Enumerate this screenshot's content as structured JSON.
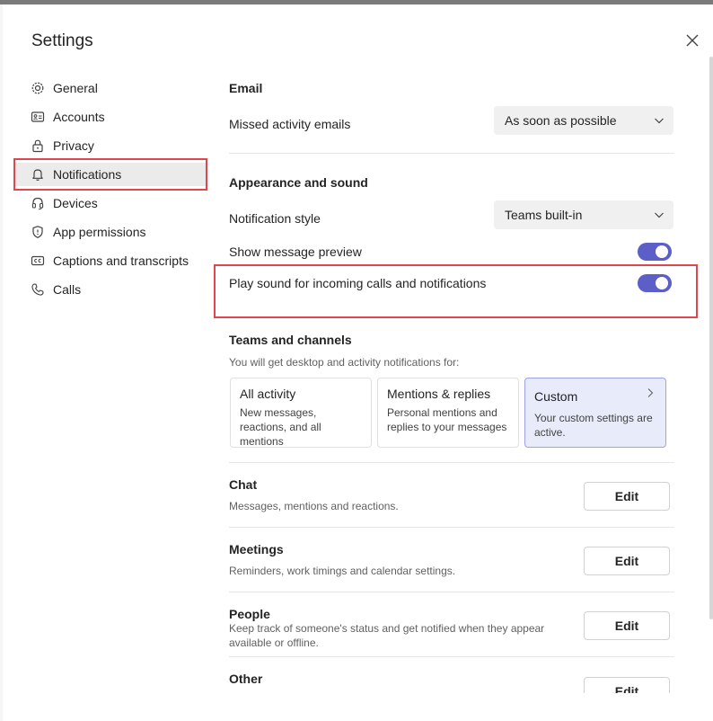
{
  "dialog": {
    "title": "Settings"
  },
  "nav": {
    "items": [
      {
        "label": "General",
        "icon": "gear-icon"
      },
      {
        "label": "Accounts",
        "icon": "id-card-icon"
      },
      {
        "label": "Privacy",
        "icon": "lock-icon"
      },
      {
        "label": "Notifications",
        "icon": "bell-icon",
        "selected": true
      },
      {
        "label": "Devices",
        "icon": "headset-icon"
      },
      {
        "label": "App permissions",
        "icon": "shield-icon"
      },
      {
        "label": "Captions and transcripts",
        "icon": "cc-icon"
      },
      {
        "label": "Calls",
        "icon": "phone-icon"
      }
    ]
  },
  "email": {
    "heading": "Email",
    "missed_label": "Missed activity emails",
    "missed_value": "As soon as possible"
  },
  "appearance": {
    "heading": "Appearance and sound",
    "style_label": "Notification style",
    "style_value": "Teams built-in",
    "preview_label": "Show message preview",
    "preview_on": true,
    "sound_label": "Play sound for incoming calls and notifications",
    "sound_on": true
  },
  "teams": {
    "heading": "Teams and channels",
    "subtitle": "You will get desktop and activity notifications for:",
    "cards": [
      {
        "title": "All activity",
        "desc": "New messages, reactions, and all mentions"
      },
      {
        "title": "Mentions & replies",
        "desc": "Personal mentions and replies to your messages"
      },
      {
        "title": "Custom",
        "desc": "Your custom settings are active.",
        "selected": true
      }
    ]
  },
  "sections": [
    {
      "title": "Chat",
      "desc": "Messages, mentions and reactions.",
      "button": "Edit"
    },
    {
      "title": "Meetings",
      "desc": "Reminders, work timings and calendar settings.",
      "button": "Edit"
    },
    {
      "title": "People",
      "desc": "Keep track of someone's status and get notified when they appear available or offline.",
      "button": "Edit"
    },
    {
      "title": "Other",
      "desc": "",
      "button": "Edit"
    }
  ],
  "colors": {
    "accent": "#5b5fc7",
    "highlight": "#e0474c",
    "selected_card": "#e8ebfa"
  }
}
